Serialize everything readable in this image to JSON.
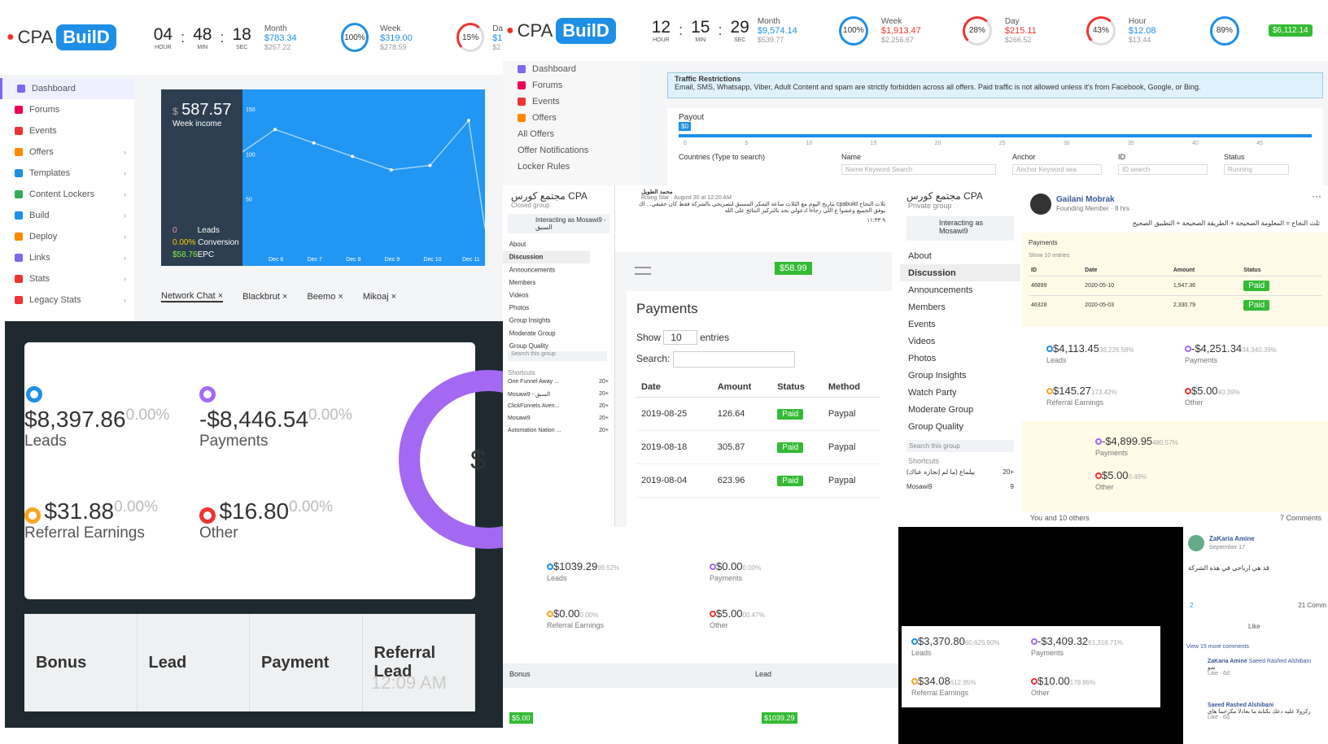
{
  "header_left": {
    "logo_cpa": "CPA",
    "logo_build": "BuilD",
    "hour": "04",
    "min": "48",
    "sec": "18",
    "hour_u": "HOUR",
    "min_u": "MIN",
    "sec_u": "SEC",
    "month_label": "Month",
    "month_val": "$783.34",
    "month_sub": "$257.22",
    "month_pct": "100%",
    "week_label": "Week",
    "week_val": "$319.00",
    "week_sub": "$278.59",
    "week_pct": "15%",
    "day_label": "Da",
    "day_val": "$1",
    "day_sub": "$2"
  },
  "sidebar": {
    "items": [
      "Dashboard",
      "Forums",
      "Events",
      "Offers",
      "Templates",
      "Content Lockers",
      "Build",
      "Deploy",
      "Links",
      "Stats",
      "Legacy Stats"
    ]
  },
  "week_chart": {
    "amount": "587.57",
    "currency": "$",
    "label": "Week income",
    "leads": "0",
    "leads_label": "Leads",
    "conv": "0.00%",
    "conv_label": "Conversion",
    "epc": "$58.76",
    "epc_label": "EPC"
  },
  "chart_data": {
    "type": "line",
    "categories": [
      "Dec 6",
      "Dec 7",
      "Dec 8",
      "Dec 9",
      "Dec 10",
      "Dec 11"
    ],
    "values": [
      130,
      115,
      100,
      85,
      90,
      140
    ],
    "yticks": [
      "150",
      "100",
      "50"
    ],
    "ylim": [
      0,
      160
    ]
  },
  "chat_tabs": [
    "Network Chat",
    "Blackbrut",
    "Beemo",
    "Mikoaj"
  ],
  "big_panel": {
    "leads_val": "$8,397.86",
    "leads_pct": "0.00%",
    "leads_lab": "Leads",
    "pay_val": "-$8,446.54",
    "pay_pct": "0.00%",
    "pay_lab": "Payments",
    "ref_val": "$31.88",
    "ref_pct": "0.00%",
    "ref_lab": "Referral Earnings",
    "oth_val": "$16.80",
    "oth_pct": "0.00%",
    "oth_lab": "Other",
    "cols": [
      "Bonus",
      "Lead",
      "Payment",
      "Referral Lead"
    ],
    "time": "12:09 AM",
    "ring_glyph": "$"
  },
  "header_right": {
    "logo_cpa": "CPA",
    "logo_build": "BuilD",
    "hour": "12",
    "min": "15",
    "sec": "29",
    "hour_u": "HOUR",
    "min_u": "MIN",
    "sec_u": "SEC",
    "month_label": "Month",
    "month_val": "$9,574.14",
    "month_sub": "$539.77",
    "month_pct": "100%",
    "week_label": "Week",
    "week_val": "$1,913.47",
    "week_sub": "$2,256.67",
    "week_pct": "28%",
    "day_label": "Day",
    "day_val": "$215.11",
    "day_sub": "$266.52",
    "day_pct": "43%",
    "hr_label": "Hour",
    "hr_val": "$12.08",
    "hr_sub": "$13.44",
    "hr_pct": "89%",
    "balance": "$6,112.14"
  },
  "side2": {
    "items": [
      "Dashboard",
      "Forums",
      "Events",
      "Offers",
      "All Offers",
      "Offer Notifications",
      "Locker Rules"
    ]
  },
  "traffic": {
    "title": "Traffic Restrictions",
    "body": "Email, SMS, Whatsapp, Viber, Adult Content and spam are strictly forbidden across all offers. Paid traffic is not allowed unless it's from Facebook, Google, or Bing."
  },
  "payout": {
    "label": "Payout",
    "badge": "$0",
    "ticks": [
      "0",
      "5",
      "10",
      "15",
      "20",
      "25",
      "30",
      "35",
      "40",
      "45"
    ],
    "cols": [
      "Countries (Type to search)",
      "Name",
      "Anchor",
      "ID",
      "Status"
    ],
    "name_ph": "Name Keyword Search",
    "anchor_ph": "Anchor Keyword sea",
    "id_ph": "ID search",
    "status_val": "Running"
  },
  "fb1": {
    "group": "مجتمع كورس CPA",
    "closed": "Closed group",
    "interacting": "Interacting as Mosawi9 - السبق",
    "menu": [
      "About",
      "Discussion",
      "Announcements",
      "Members",
      "Videos",
      "Photos",
      "Group Insights",
      "Moderate Group",
      "Group Quality"
    ],
    "search": "Search this group",
    "shortcuts": "Shortcuts",
    "sc": [
      "One Funnel Away ...",
      "Mosawi9 - السبق",
      "ClickFunnels Aven...",
      "Mosawi9",
      "Automation Nation ..."
    ],
    "badge": "20+"
  },
  "post1": {
    "name": "محمد الطويل",
    "meta": "Rising Star · August 30 at 12:20 AM",
    "text": "ثلاث النجاح cpabuild بتاريخ اليوم مع الثلاث ساعة الشكر المسبق لتصريحي بالشركة فقط كان حقيقي... اك",
    "text2": "يوفق الجميع وعشوا ع اللي رجاءا ادعولي بحد بالتركيز النتائج على الله",
    "time": "٩ ١١:٣٣"
  },
  "pay_mobile": {
    "balance": "$58.99",
    "title": "Payments",
    "show": "Show",
    "entries_val": "10",
    "entries": "entries",
    "search": "Search:",
    "cols": [
      "Date",
      "Amount",
      "Status",
      "Method"
    ],
    "rows": [
      {
        "date": "2019-08-25",
        "amount": "126.64",
        "status": "Paid",
        "method": "Paypal"
      },
      {
        "date": "2019-08-18",
        "amount": "305.87",
        "status": "Paid",
        "method": "Paypal"
      },
      {
        "date": "2019-08-04",
        "amount": "623.96",
        "status": "Paid",
        "method": "Paypal"
      }
    ]
  },
  "fb2": {
    "group": "مجتمع كورس CPA",
    "private": "Private group",
    "interacting": "Interacting as Mosawi9",
    "menu": [
      "About",
      "Discussion",
      "Announcements",
      "Members",
      "Events",
      "Videos",
      "Photos",
      "Group Insights",
      "Watch Party",
      "Moderate Group",
      "Group Quality"
    ],
    "search": "Search this group",
    "shortcuts": "Shortcuts",
    "sc": [
      "بيلماع (ما لم إنجازه عناك)",
      "Mosawi9"
    ],
    "sc_badges": [
      "20+",
      "9"
    ]
  },
  "post2": {
    "name": "Gailani Mobrak",
    "meta": "Founding Member · 8 hrs",
    "text": "ثلث النجاح = المعلومة الصحيحة + الطريقة الصحيحة + التطبيق الصحيح",
    "pay_title": "Payments",
    "show": "Show 10 entries",
    "cols": [
      "ID",
      "Date",
      "Amount",
      "Status"
    ],
    "rows": [
      {
        "id": "46899",
        "date": "2020-05-10",
        "amount": "1,547.36",
        "status": "Paid"
      },
      {
        "id": "46328",
        "date": "2020-05-03",
        "amount": "2,330.79",
        "status": "Paid"
      }
    ],
    "s1": [
      {
        "val": "$4,113.45",
        "pct": "33,226.58%",
        "lab": "Leads"
      },
      {
        "val": "-$4,251.34",
        "pct": "34,340.39%",
        "lab": "Payments"
      },
      {
        "val": "$145.27",
        "pct": "173.42%",
        "lab": "Referral Earnings"
      },
      {
        "val": "$5.00",
        "pct": "40.39%",
        "lab": "Other"
      }
    ],
    "s2": [
      {
        "val": "-$4,899.95",
        "pct": "480.57%",
        "lab": "Payments"
      },
      {
        "val": "$5.00",
        "pct": "0.49%",
        "lab": "Other"
      }
    ],
    "likes": "You and 10 others",
    "comments": "7 Comments"
  },
  "stats_mid": {
    "items": [
      {
        "val": "$1039.29",
        "pct": "99.52%",
        "lab": "Leads"
      },
      {
        "val": "$0.00",
        "pct": "0.00%",
        "lab": "Payments"
      },
      {
        "val": "$0.00",
        "pct": "0.00%",
        "lab": "Referral Earnings"
      },
      {
        "val": "$5.00",
        "pct": "00.47%",
        "lab": "Other"
      }
    ],
    "bonus": "Bonus",
    "lead": "Lead",
    "bonus_val": "$5.00",
    "lead_val": "$1039.29"
  },
  "stats_dark": {
    "items": [
      {
        "val": "$3,370.80",
        "pct": "60,625.90%",
        "lab": "Leads"
      },
      {
        "val": "-$3,409.32",
        "pct": "61,318.71%",
        "lab": "Payments"
      },
      {
        "val": "$34.08",
        "pct": "612.95%",
        "lab": "Referral Earnings"
      },
      {
        "val": "$10.00",
        "pct": "179.86%",
        "lab": "Other"
      }
    ]
  },
  "comments": {
    "n1": "ZaKaria Amine",
    "d1": "September 17",
    "t1": "قد هي ارباحي في هذه الشركة",
    "likes": "2",
    "cc": "21 Comm",
    "like": "Like",
    "more": "View 15 more comments",
    "n2": "ZaKaria Amine",
    "n2b": "Saeed Rashed Alshibani",
    "t2": "شو",
    "act": "Like · 6d",
    "n3": "Saeed Rashed Alshibani",
    "t3": "ركزولا عليه دعك بكتابة ما بعادلا مكرحينا هاي",
    "act3": "Like · 6d"
  }
}
